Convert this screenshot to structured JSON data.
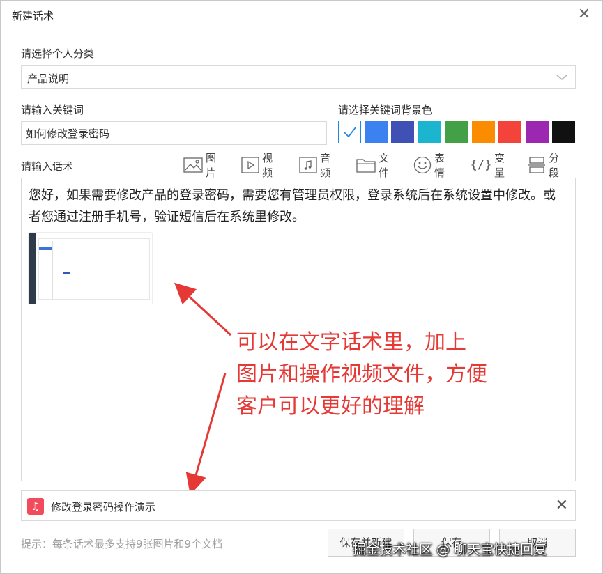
{
  "dialog": {
    "title": "新建话术",
    "close_glyph": "✕"
  },
  "category": {
    "label": "请选择个人分类",
    "value": "产品说明"
  },
  "keyword": {
    "label": "请输入关键词",
    "value": "如何修改登录密码"
  },
  "bg_color": {
    "label": "请选择关键词背景色",
    "colors": [
      "#ffffff",
      "#3b82f0",
      "#3f51b5",
      "#1cb5d0",
      "#43a047",
      "#fb8c00",
      "#f4433a",
      "#9c27b0",
      "#111111"
    ]
  },
  "script": {
    "label": "请输入话术",
    "text": "您好，如果需要修改产品的登录密码，需要您有管理员权限，登录系统后在系统设置中修改。或者您通过注册手机号，验证短信后在系统里修改。"
  },
  "toolbar": {
    "image": "图片",
    "video": "视频",
    "audio": "音频",
    "file": "文件",
    "emoji": "表情",
    "variable": "变量",
    "segment": "分段",
    "variable_icon_text": "{/}"
  },
  "annotation": {
    "line1": "可以在文字话术里，加上",
    "line2": "图片和操作视频文件，方便",
    "line3": "客户可以更好的理解"
  },
  "attachment": {
    "icon": "♫",
    "name": "修改登录密码操作演示",
    "close_glyph": "✕"
  },
  "footer": {
    "hint": "提示：每条话术最多支持9张图片和9个文档",
    "save_new": "保存并新建",
    "save": "保存",
    "cancel": "取消"
  },
  "watermark": "掘金技术社区 @ 聊天宝快捷回复"
}
